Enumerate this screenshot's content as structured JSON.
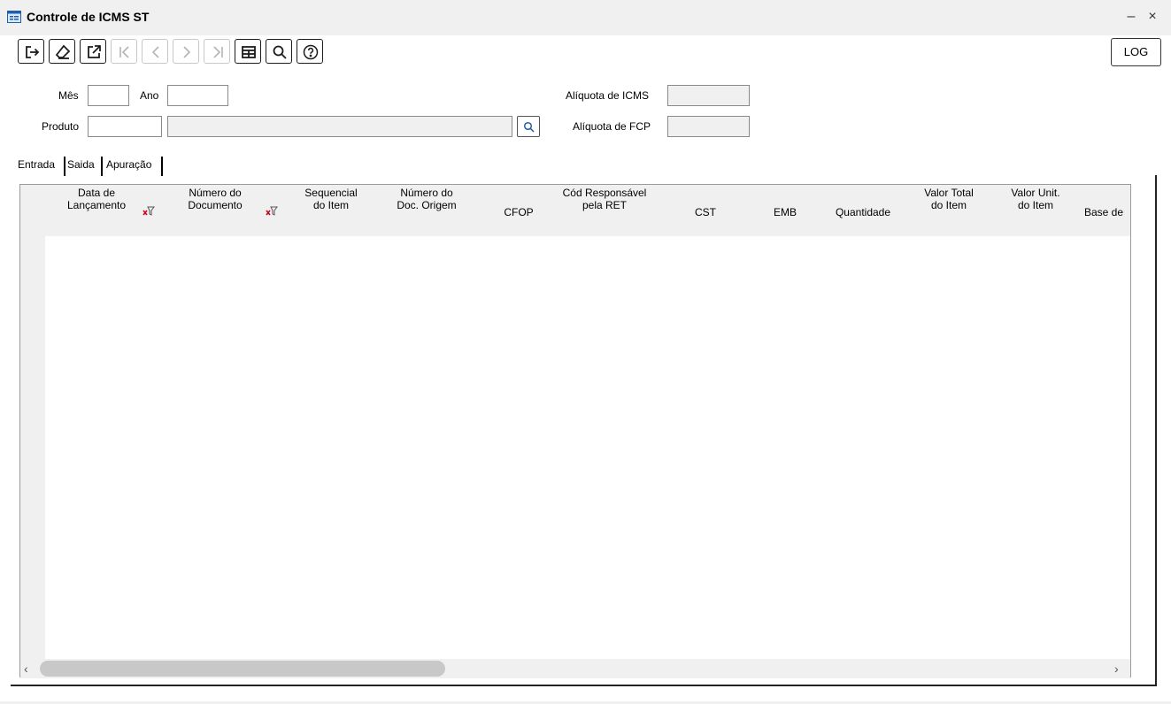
{
  "window": {
    "title": "Controle de ICMS ST",
    "minimize": "–",
    "close": "×"
  },
  "toolbar": {
    "buttons": [
      {
        "icon": "exit-icon",
        "enabled": true
      },
      {
        "icon": "eraser-icon",
        "enabled": true
      },
      {
        "icon": "export-icon",
        "enabled": true
      },
      {
        "icon": "first-record-icon",
        "enabled": false
      },
      {
        "icon": "previous-record-icon",
        "enabled": false
      },
      {
        "icon": "next-record-icon",
        "enabled": false
      },
      {
        "icon": "last-record-icon",
        "enabled": false
      },
      {
        "icon": "grid-view-icon",
        "enabled": true
      },
      {
        "icon": "search-icon",
        "enabled": true
      },
      {
        "icon": "help-icon",
        "enabled": true
      }
    ],
    "log_label": "LOG"
  },
  "form": {
    "mes_label": "Mês",
    "ano_label": "Ano",
    "produto_label": "Produto",
    "aliquota_icms_label": "Alíquota de ICMS",
    "aliquota_fcp_label": "Alíquota de FCP",
    "mes_value": "",
    "ano_value": "",
    "produto_code": "",
    "produto_desc": "",
    "aliquota_icms_value": "",
    "aliquota_fcp_value": ""
  },
  "tabs": [
    "Entrada",
    "Saida",
    "Apuração"
  ],
  "grid": {
    "columns": [
      {
        "line1": "Data de",
        "line2": "Lançamento",
        "filter": true
      },
      {
        "line1": "Número do",
        "line2": "Documento",
        "filter": true
      },
      {
        "line1": "Sequencial",
        "line2": "do Item"
      },
      {
        "line1": "Número do",
        "line2": "Doc. Origem"
      },
      {
        "line1": "",
        "line2": "CFOP"
      },
      {
        "line1": "Cód Responsável",
        "line2": "pela RET"
      },
      {
        "line1": "",
        "line2": "CST"
      },
      {
        "line1": "",
        "line2": "EMB"
      },
      {
        "line1": "",
        "line2": "Quantidade"
      },
      {
        "line1": "Valor Total",
        "line2": "do Item"
      },
      {
        "line1": "Valor Unit.",
        "line2": "do Item"
      },
      {
        "line1": "",
        "line2": "Base de"
      }
    ],
    "scroll_left": "‹",
    "scroll_right": "›"
  }
}
